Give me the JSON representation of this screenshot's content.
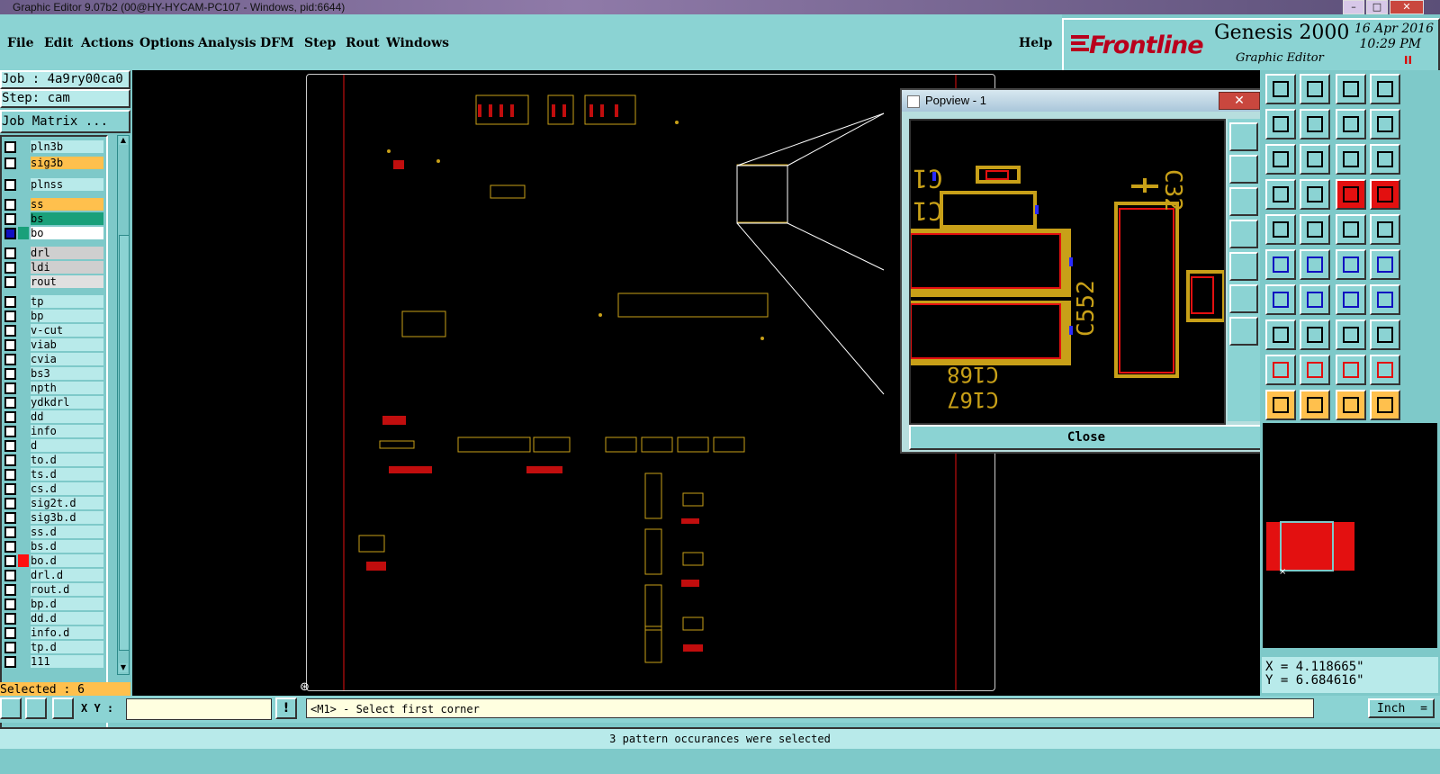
{
  "window": {
    "title": "Graphic Editor 9.07b2 (00@HY-HYCAM-PC107 - Windows, pid:6644)",
    "btn_min": "–",
    "btn_max": "□",
    "btn_close": "✕"
  },
  "menu": {
    "items": [
      "File",
      "Edit",
      "Actions",
      "Options",
      "Analysis",
      "DFM",
      "Step",
      "Rout",
      "Windows"
    ],
    "help": "Help"
  },
  "brand": {
    "logo": "Frontline",
    "product": "Genesis 2000",
    "subtitle": "Graphic Editor",
    "date": "16 Apr 2016",
    "time": "10:29 PM",
    "pause": "II"
  },
  "job": {
    "job": "Job : 4a9ry00ca0",
    "step": "Step: cam",
    "matrix_button": "Job Matrix ..."
  },
  "layers": [
    {
      "name": "pln3b",
      "color": "#b8eaea"
    },
    {
      "name": "sig3b",
      "color": "#ffc04d"
    },
    {
      "name": "plnss",
      "color": "#b8eaea"
    },
    {
      "name": "ss",
      "color": "#ffc04d"
    },
    {
      "name": "bs",
      "color": "#19a07a"
    },
    {
      "name": "bo",
      "color": "#ffffff",
      "active": true
    },
    {
      "name": "drl",
      "color": "#cfcfcf"
    },
    {
      "name": "ldi",
      "color": "#cfcfcf"
    },
    {
      "name": "rout",
      "color": "#e0e0e0"
    },
    {
      "name": "tp",
      "color": "#b8eaea"
    },
    {
      "name": "bp",
      "color": "#b8eaea"
    },
    {
      "name": "v-cut",
      "color": "#b8eaea"
    },
    {
      "name": "viab",
      "color": "#b8eaea"
    },
    {
      "name": "cvia",
      "color": "#b8eaea"
    },
    {
      "name": "bs3",
      "color": "#b8eaea"
    },
    {
      "name": "npth",
      "color": "#b8eaea"
    },
    {
      "name": "ydkdrl",
      "color": "#b8eaea"
    },
    {
      "name": "dd",
      "color": "#b8eaea"
    },
    {
      "name": "info",
      "color": "#b8eaea"
    },
    {
      "name": "d",
      "color": "#b8eaea"
    },
    {
      "name": "to.d",
      "color": "#b8eaea"
    },
    {
      "name": "ts.d",
      "color": "#b8eaea"
    },
    {
      "name": "cs.d",
      "color": "#b8eaea"
    },
    {
      "name": "sig2t.d",
      "color": "#b8eaea"
    },
    {
      "name": "sig3b.d",
      "color": "#b8eaea"
    },
    {
      "name": "ss.d",
      "color": "#b8eaea"
    },
    {
      "name": "bs.d",
      "color": "#b8eaea"
    },
    {
      "name": "bo.d",
      "color": "#b8eaea",
      "marker": "#ff1010"
    },
    {
      "name": "drl.d",
      "color": "#b8eaea"
    },
    {
      "name": "rout.d",
      "color": "#b8eaea"
    },
    {
      "name": "bp.d",
      "color": "#b8eaea"
    },
    {
      "name": "dd.d",
      "color": "#b8eaea"
    },
    {
      "name": "info.d",
      "color": "#b8eaea"
    },
    {
      "name": "tp.d",
      "color": "#b8eaea"
    },
    {
      "name": "111",
      "color": "#b8eaea"
    }
  ],
  "selected_text": "Selected : 6",
  "popview": {
    "title": "Popview - 1",
    "close_button": "Close",
    "labels": {
      "c1a": "C1",
      "c1b": "C1",
      "c32": "C32",
      "c552": "C552",
      "c168": "C168",
      "c167": "C167",
      "plus": "+"
    }
  },
  "coords": {
    "x": "X = 4.118665\"",
    "y": "Y = 6.684616\""
  },
  "bottom": {
    "xy_label": "X Y :",
    "xy_value": "",
    "prompt_button": "!",
    "prompt": "<M1> - Select first corner",
    "units": "Inch"
  },
  "status": "3 pattern occurances were selected",
  "colors": {
    "pcb_gold": "#c8a018",
    "pcb_red": "#e31010",
    "canvas": "#000000",
    "panel": "#7ec9c9"
  }
}
